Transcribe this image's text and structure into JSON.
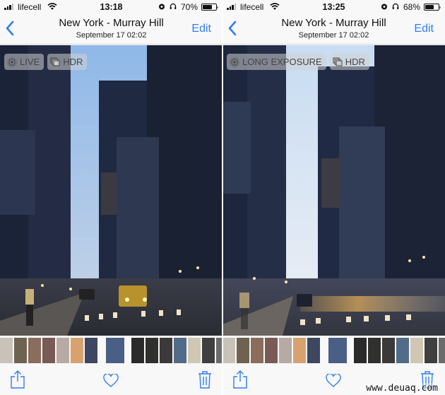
{
  "screens": [
    {
      "status": {
        "carrier": "lifecell",
        "time": "13:18",
        "battery_pct": "70%",
        "battery_level": 0.7
      },
      "nav": {
        "back_label": "Back",
        "title": "New York - Murray Hill",
        "subtitle": "September 17  02:02",
        "edit_label": "Edit"
      },
      "badges": [
        {
          "icon": "live-photo-icon",
          "label": "LIVE"
        },
        {
          "icon": "hdr-icon",
          "label": "HDR"
        }
      ],
      "photo": {
        "description": "Street view between skyscrapers at dusk, cars with headlights, pedestrians",
        "effect": "live"
      },
      "toolbar": {
        "share": "share-icon",
        "favorite": "heart-icon",
        "delete": "trash-icon"
      }
    },
    {
      "status": {
        "carrier": "lifecell",
        "time": "13:25",
        "battery_pct": "68%",
        "battery_level": 0.68
      },
      "nav": {
        "back_label": "Back",
        "title": "New York - Murray Hill",
        "subtitle": "September 17  02:02",
        "edit_label": "Edit"
      },
      "badges": [
        {
          "icon": "long-exposure-icon",
          "label": "LONG EXPOSURE"
        },
        {
          "icon": "hdr-icon",
          "label": "HDR"
        }
      ],
      "photo": {
        "description": "Same street view with long-exposure motion blur of traffic",
        "effect": "long-exposure"
      },
      "toolbar": {
        "share": "share-icon",
        "favorite": "heart-icon",
        "delete": "trash-icon"
      }
    }
  ],
  "filmstrip": {
    "thumbs_before": [
      "#c9c2b8",
      "#6f6250",
      "#8a6d5c",
      "#7a5a55",
      "#b7a9a3",
      "#d8a270",
      "#3e4760"
    ],
    "current": "#4a5f86",
    "thumbs_after": [
      "#2a2a2a",
      "#30302e",
      "#3b3a38",
      "#526b88",
      "#cfc7b4",
      "#3f3f3f",
      "#6b6b6b"
    ]
  },
  "colors": {
    "accent": "#2f7cf6",
    "bar_bg": "#f8f8f8"
  },
  "watermark": "www.deuaq.com"
}
